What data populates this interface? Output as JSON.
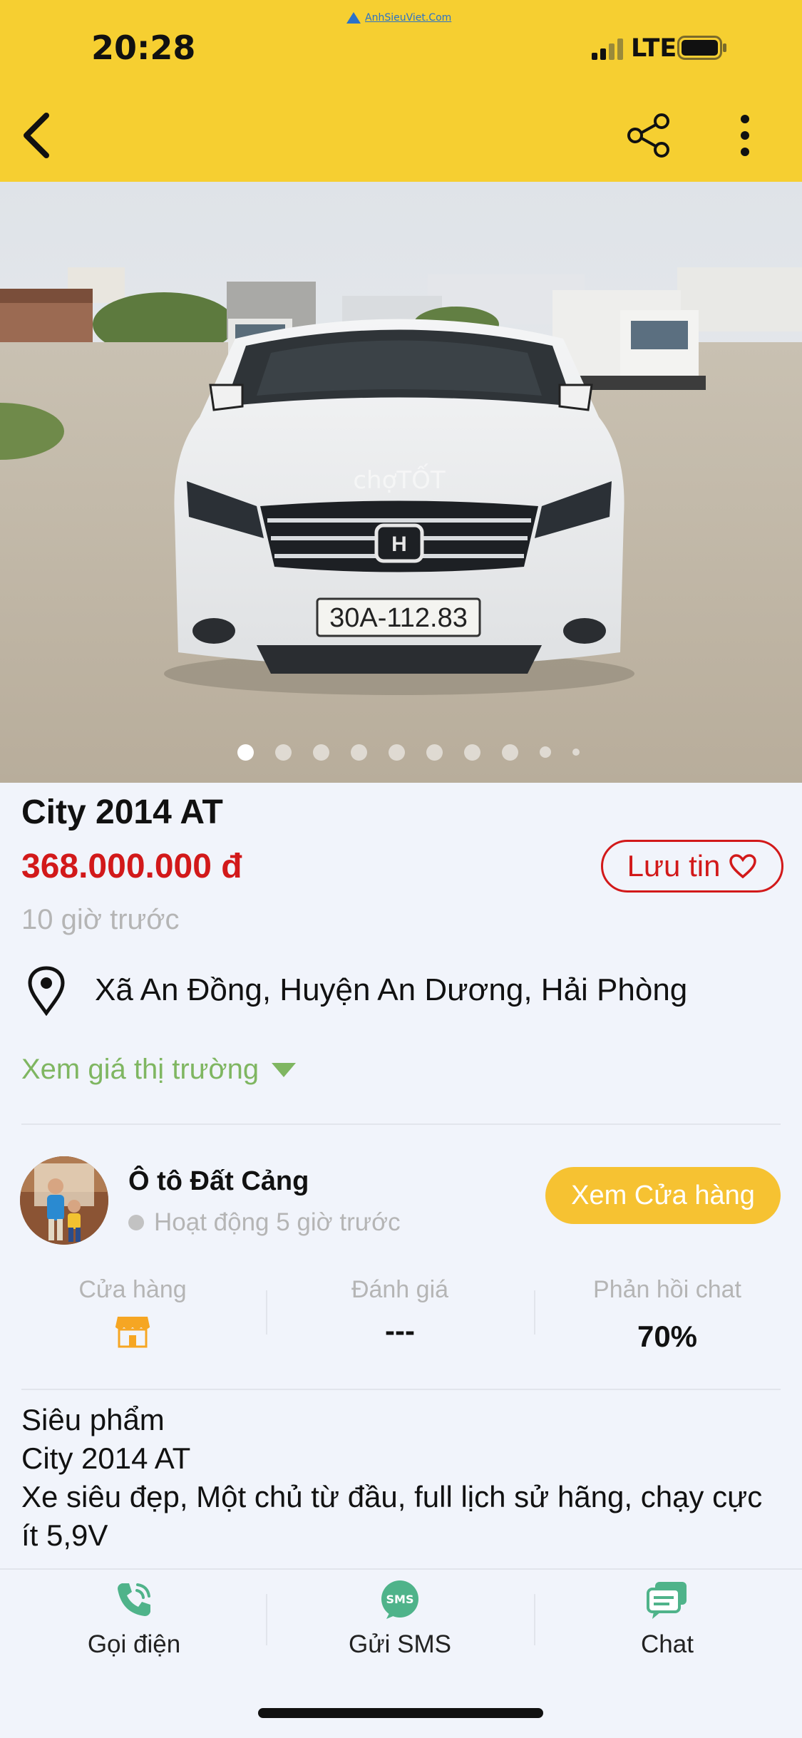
{
  "watermark": "AnhSieuViet.Com",
  "status_bar": {
    "time": "20:28",
    "network": "LTE"
  },
  "header": {
    "back_icon": "chevron-left-icon",
    "share_icon": "share-icon",
    "more_icon": "more-vertical-icon"
  },
  "gallery": {
    "photo_count": 10,
    "active_index": 0,
    "plate_text": "30A-112.83",
    "photo_watermark": "chợTỐT"
  },
  "listing": {
    "title": "City 2014 AT",
    "price": "368.000.000 đ",
    "save_label": "Lưu tin",
    "posted": "10 giờ trước",
    "location": "Xã An Đồng, Huyện An Dương, Hải Phòng",
    "market_price_link": "Xem giá thị trường"
  },
  "seller": {
    "name": "Ô tô Đất Cảng",
    "status": "Hoạt động 5 giờ trước",
    "store_button": "Xem Cửa hàng",
    "stats": [
      {
        "label": "Cửa hàng",
        "value": ""
      },
      {
        "label": "Đánh giá",
        "value": "---"
      },
      {
        "label": "Phản hồi chat",
        "value": "70%"
      }
    ]
  },
  "description": "Siêu phẩm\nCity 2014 AT\nXe siêu đẹp, Một chủ từ đầu, full lịch sử hãng, chạy cực ít 5,9V",
  "actions": [
    {
      "label": "Gọi điện",
      "icon": "phone-icon"
    },
    {
      "label": "Gửi SMS",
      "icon": "sms-icon",
      "icon_text": "SMS"
    },
    {
      "label": "Chat",
      "icon": "chat-icon"
    }
  ],
  "colors": {
    "header": "#f6cf31",
    "price": "#d2191a",
    "accent_green": "#7fb661",
    "store_button": "#f6c232"
  }
}
